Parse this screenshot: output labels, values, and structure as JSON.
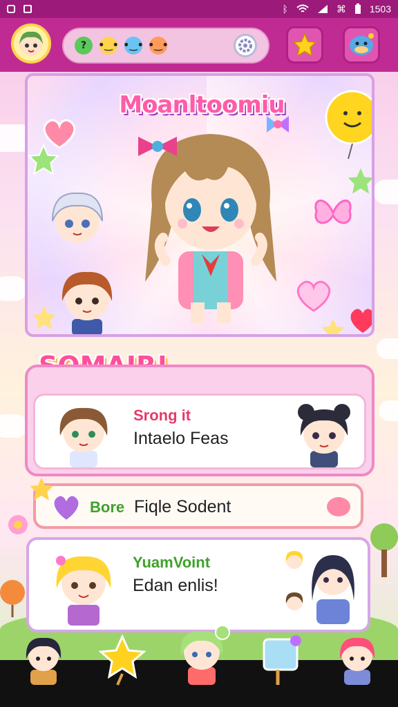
{
  "status_bar": {
    "time": "1503"
  },
  "header": {
    "search_icons": [
      "map-pin-icon",
      "blob-yellow-icon",
      "blob-blue-icon",
      "blob-orange-icon"
    ],
    "settings_icon": "settings-icon",
    "favorites_icon": "star-icon",
    "mascot_icon": "mascot-icon"
  },
  "hero": {
    "title": "Moanltoomiu"
  },
  "section": {
    "title": "SOMAIR!"
  },
  "cards": [
    {
      "label": "Srong it",
      "text": "Intaelo Feas"
    },
    {
      "label": "Bore",
      "text": "Fiqle Sodent"
    },
    {
      "label": "YuamVoint",
      "text": "Edan enlis!"
    }
  ],
  "colors": {
    "status_bar": "#9c1a7a",
    "header": "#c02b93",
    "accent_pink": "#ff4f9a",
    "accent_green": "#3ea22b",
    "nav": "#111111"
  }
}
